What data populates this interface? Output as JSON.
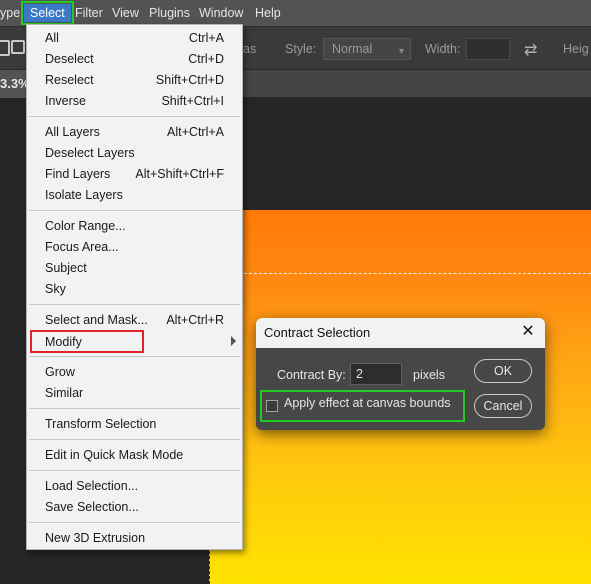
{
  "menubar": {
    "items": [
      "ype",
      "Select",
      "Filter",
      "View",
      "Plugins",
      "Window",
      "Help"
    ],
    "active_index": 1
  },
  "options": {
    "partial_label": "as",
    "style_label": "Style:",
    "style_value": "Normal",
    "width_label": "Width:",
    "height_label": "Heig"
  },
  "doc_tab": {
    "zoom": "3.3%"
  },
  "select_menu": {
    "items": [
      {
        "label": "All",
        "shortcut": "Ctrl+A"
      },
      {
        "label": "Deselect",
        "shortcut": "Ctrl+D"
      },
      {
        "label": "Reselect",
        "shortcut": "Shift+Ctrl+D"
      },
      {
        "label": "Inverse",
        "shortcut": "Shift+Ctrl+I"
      },
      {
        "label": "All Layers",
        "shortcut": "Alt+Ctrl+A"
      },
      {
        "label": "Deselect Layers",
        "shortcut": ""
      },
      {
        "label": "Find Layers",
        "shortcut": "Alt+Shift+Ctrl+F"
      },
      {
        "label": "Isolate Layers",
        "shortcut": ""
      },
      {
        "label": "Color Range...",
        "shortcut": ""
      },
      {
        "label": "Focus Area...",
        "shortcut": ""
      },
      {
        "label": "Subject",
        "shortcut": ""
      },
      {
        "label": "Sky",
        "shortcut": ""
      },
      {
        "label": "Select and Mask...",
        "shortcut": "Alt+Ctrl+R"
      },
      {
        "label": "Modify",
        "shortcut": ""
      },
      {
        "label": "Grow",
        "shortcut": ""
      },
      {
        "label": "Similar",
        "shortcut": ""
      },
      {
        "label": "Transform Selection",
        "shortcut": ""
      },
      {
        "label": "Edit in Quick Mask Mode",
        "shortcut": ""
      },
      {
        "label": "Load Selection...",
        "shortcut": ""
      },
      {
        "label": "Save Selection...",
        "shortcut": ""
      },
      {
        "label": "New 3D Extrusion",
        "shortcut": ""
      }
    ]
  },
  "dialog": {
    "title": "Contract Selection",
    "contract_label": "Contract By:",
    "contract_value": "2",
    "unit": "pixels",
    "checkbox_label": "Apply effect at canvas bounds",
    "checkbox_checked": false,
    "ok_label": "OK",
    "cancel_label": "Cancel"
  },
  "colors": {
    "highlight_green": "#22cc22",
    "highlight_red": "#e0222a",
    "canvas_top": "#ff7a0a",
    "canvas_bottom": "#ffe300"
  }
}
